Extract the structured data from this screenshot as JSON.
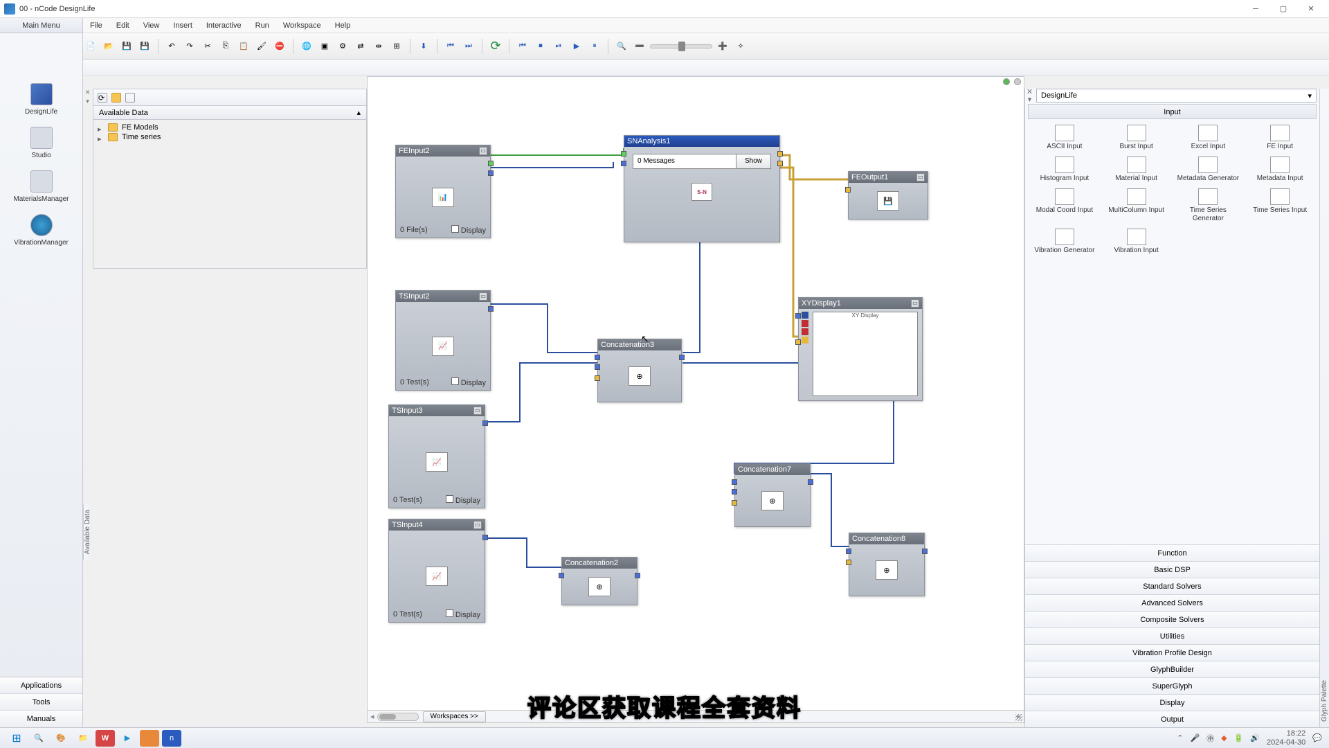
{
  "window": {
    "title": "00 - nCode DesignLife"
  },
  "menu": {
    "items": [
      "File",
      "Edit",
      "View",
      "Insert",
      "Interactive",
      "Run",
      "Workspace",
      "Help"
    ]
  },
  "main_menu": {
    "header": "Main Menu",
    "items": [
      {
        "label": "DesignLife"
      },
      {
        "label": "Studio"
      },
      {
        "label": "MaterialsManager"
      },
      {
        "label": "VibrationManager"
      }
    ],
    "footer": [
      "Applications",
      "Tools",
      "Manuals"
    ]
  },
  "available_data": {
    "title": "Available Data",
    "vertical_label": "Available Data",
    "tree": [
      {
        "label": "FE Models"
      },
      {
        "label": "Time series"
      }
    ]
  },
  "canvas": {
    "blocks": {
      "fein": {
        "title": "FEInput2",
        "files": "0 File(s)",
        "display": "Display"
      },
      "sna": {
        "title": "SNAnalysis1",
        "messages": "0 Messages",
        "show": "Show"
      },
      "feo": {
        "title": "FEOutput1"
      },
      "ts2": {
        "title": "TSInput2",
        "tests": "0 Test(s)",
        "display": "Display"
      },
      "ts3": {
        "title": "TSInput3",
        "tests": "0 Test(s)",
        "display": "Display"
      },
      "ts4": {
        "title": "TSInput4",
        "tests": "0 Test(s)",
        "display": "Display"
      },
      "con2": {
        "title": "Concatenation2"
      },
      "con3": {
        "title": "Concatenation3"
      },
      "con7": {
        "title": "Concatenation7"
      },
      "con8": {
        "title": "Concatenation8"
      },
      "xy": {
        "title": "XYDisplay1",
        "plot_title": "XY Display"
      }
    },
    "workspaces_btn": "Workspaces >>"
  },
  "palette": {
    "vertical_label": "Glyph Palette",
    "selector": "DesignLife",
    "category_header": "Input",
    "items": [
      "ASCII Input",
      "Burst Input",
      "Excel Input",
      "FE Input",
      "Histogram Input",
      "Material Input",
      "Metadata Generator",
      "Metadata Input",
      "Modal Coord Input",
      "MultiColumn Input",
      "Time Series Generator",
      "Time Series Input",
      "Vibration Generator",
      "Vibration Input"
    ],
    "categories": [
      "Function",
      "Basic DSP",
      "Standard Solvers",
      "Advanced Solvers",
      "Composite Solvers",
      "Utilities",
      "Vibration Profile Design",
      "GlyphBuilder",
      "SuperGlyph",
      "Display",
      "Output"
    ]
  },
  "taskbar": {
    "time": "18:22",
    "date": "2024-04-30"
  },
  "subtitle": "评论区获取课程全套资料"
}
